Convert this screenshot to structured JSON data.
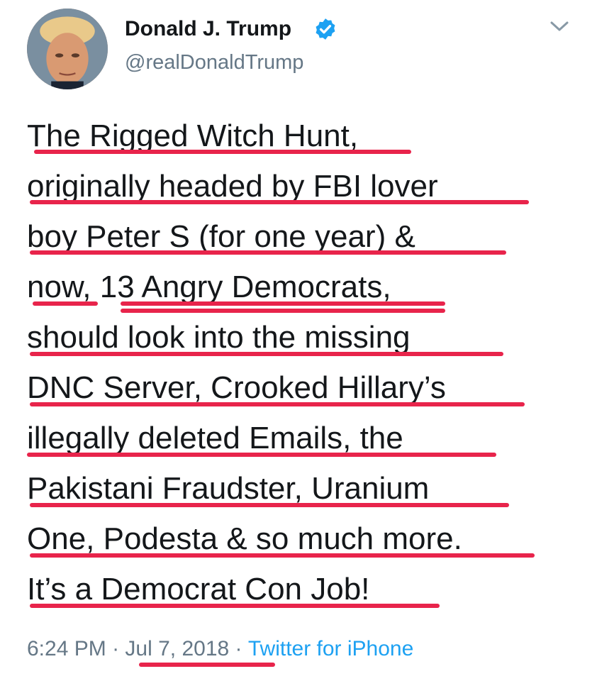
{
  "user": {
    "display_name": "Donald J. Trump",
    "handle": "@realDonaldTrump",
    "verified": true,
    "avatar_icon": "profile-photo"
  },
  "menu": {
    "icon": "chevron-down-icon"
  },
  "tweet": {
    "lines": [
      "The Rigged Witch Hunt,",
      "originally headed by FBI lover",
      "boy Peter S (for one year) &",
      "now, 13 Angry Democrats,",
      "should look into the missing",
      "DNC Server, Crooked Hillary’s",
      "illegally deleted Emails, the",
      "Pakistani Fraudster, Uranium",
      "One, Podesta & so much more.",
      "It’s a Democrat Con Job!"
    ]
  },
  "meta": {
    "time": "6:24 PM",
    "sep1": " · ",
    "date": "Jul 7, 2018",
    "sep2": " · ",
    "source": "Twitter for iPhone"
  },
  "colors": {
    "text": "#14171a",
    "secondary": "#657786",
    "link": "#1da1f2",
    "underline": "#e8244b",
    "verified": "#1da1f2"
  }
}
